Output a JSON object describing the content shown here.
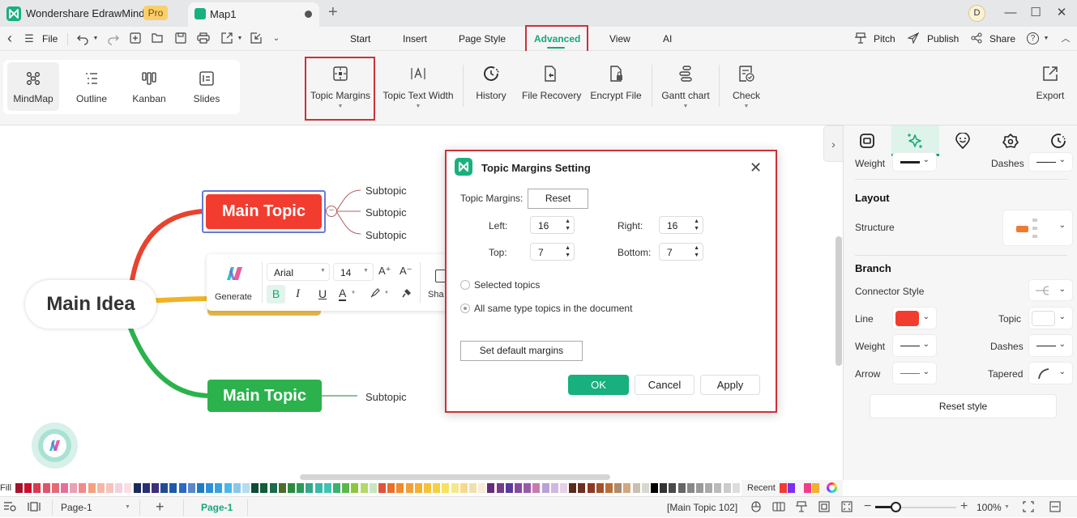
{
  "titlebar": {
    "app_title": "Wondershare EdrawMind",
    "badge": "Pro",
    "doc_tab": "Map1",
    "new_tab_symbol": "+",
    "avatar_initial": "D",
    "minimize": "—",
    "maximize": "☐",
    "close": "✕"
  },
  "menubar": {
    "back": "‹",
    "menu": "☰",
    "file": "File",
    "tabs": [
      "Start",
      "Insert",
      "Page Style",
      "Advanced",
      "View",
      "AI"
    ],
    "active_tab": "Advanced",
    "right": {
      "pitch": "Pitch",
      "publish": "Publish",
      "share": "Share",
      "help": "?"
    }
  },
  "ribbon": {
    "views": [
      {
        "label": "MindMap",
        "icon": "mindmap-icon",
        "active": true
      },
      {
        "label": "Outline",
        "icon": "outline-icon",
        "active": false
      },
      {
        "label": "Kanban",
        "icon": "kanban-icon",
        "active": false
      },
      {
        "label": "Slides",
        "icon": "slides-icon",
        "active": false
      }
    ],
    "tools": [
      {
        "label": "Topic Margins",
        "icon": "topic-margins-icon",
        "dropdown": true,
        "highlighted": true
      },
      {
        "label": "Topic Text Width",
        "icon": "text-width-icon",
        "dropdown": true
      },
      {
        "label": "History",
        "icon": "history-icon",
        "dropdown": false
      },
      {
        "label": "File Recovery",
        "icon": "file-recovery-icon",
        "dropdown": false
      },
      {
        "label": "Encrypt File",
        "icon": "encrypt-file-icon",
        "dropdown": false
      },
      {
        "label": "Gantt chart",
        "icon": "gantt-icon",
        "dropdown": true
      },
      {
        "label": "Check",
        "icon": "check-icon",
        "dropdown": true
      }
    ],
    "export": "Export"
  },
  "canvas": {
    "main_idea": "Main Idea",
    "topics": [
      {
        "label": "Main Topic",
        "color": "#f23c2f",
        "selected": true,
        "subtopics": [
          "Subtopic",
          "Subtopic",
          "Subtopic"
        ]
      },
      {
        "label": "Main Topic",
        "color": "#2bb24c",
        "selected": false,
        "subtopics": [
          "Subtopic"
        ]
      }
    ],
    "branch_colors": {
      "red": "#e8432f",
      "yellow": "#f0b323",
      "green": "#2bb24c"
    }
  },
  "float_toolbar": {
    "generate": "Generate",
    "font": "Arial",
    "size": "14",
    "grow": "A⁺",
    "shrink": "A⁻",
    "bold": "B",
    "italic": "I",
    "underline": "U",
    "font_color": "A",
    "shape_partial": "Sha"
  },
  "dialog": {
    "title": "Topic Margins Setting",
    "margins_label": "Topic Margins:",
    "reset": "Reset",
    "left_label": "Left:",
    "left_value": "16",
    "right_label": "Right:",
    "right_value": "16",
    "top_label": "Top:",
    "top_value": "7",
    "bottom_label": "Bottom:",
    "bottom_value": "7",
    "option_selected": "Selected topics",
    "option_all": "All same type topics in the document",
    "selected_option": "All same type topics in the document",
    "set_default": "Set default margins",
    "ok": "OK",
    "cancel": "Cancel",
    "apply": "Apply"
  },
  "right_panel": {
    "tabs": [
      "style-icon",
      "ai-sparkle-icon",
      "icon-marker-icon",
      "theme-icon",
      "clock-icon"
    ],
    "active_tab": 1,
    "weight_label": "Weight",
    "dashes_label": "Dashes",
    "layout_heading": "Layout",
    "structure_label": "Structure",
    "branch_heading": "Branch",
    "connector_label": "Connector Style",
    "line_label": "Line",
    "line_color": "#f23c2f",
    "topic_label": "Topic",
    "branch_weight_label": "Weight",
    "branch_dashes_label": "Dashes",
    "arrow_label": "Arrow",
    "tapered_label": "Tapered",
    "reset_style": "Reset style"
  },
  "palette": {
    "fill_label": "Fill",
    "recent_label": "Recent",
    "colors": [
      "#a3142c",
      "#c8102e",
      "#d93a4f",
      "#e0546b",
      "#e56a78",
      "#e86e9a",
      "#eaa0b8",
      "#f28a8a",
      "#f4a07d",
      "#f5b8a8",
      "#f6c4bc",
      "#efd3de",
      "#fadfe5",
      "#1b2a5a",
      "#28306e",
      "#3d2f7a",
      "#234b8f",
      "#1f5aa6",
      "#2d68c4",
      "#5a86cc",
      "#1f7cc4",
      "#2e8fd8",
      "#3aa0e0",
      "#4db7ea",
      "#8cc7e8",
      "#b6dcf0",
      "#0f4a3a",
      "#145c3a",
      "#1c6b4a",
      "#4c6b2e",
      "#2a8a3e",
      "#2a9a5a",
      "#36a88a",
      "#3ab8a8",
      "#40c4b0",
      "#3cb070",
      "#5ab84a",
      "#8dc63f",
      "#b5d86a",
      "#c8e6c0",
      "#e0523a",
      "#e8702a",
      "#f08a2a",
      "#f0a03a",
      "#f4b030",
      "#f5c23a",
      "#f6d040",
      "#f8e060",
      "#f5e88a",
      "#f8d890",
      "#f0e0b0",
      "#f8ecd8",
      "#6a2a7a",
      "#7a3a8a",
      "#5a3a9a",
      "#8a4a9a",
      "#9a5aa8",
      "#c87ab0",
      "#b8a0d8",
      "#d0b8e0",
      "#e8d0e8",
      "#5a2a1a",
      "#6a3020",
      "#8a3a20",
      "#a0522d",
      "#b8703a",
      "#b08a6a",
      "#d0a880",
      "#c8c0b0",
      "#d8d8d0",
      "#000000",
      "#333333",
      "#4a4a4a",
      "#666666",
      "#888888",
      "#999999",
      "#aaaaaa",
      "#bbbbbb",
      "#cccccc",
      "#dddddd"
    ],
    "recent_colors": [
      "#f23c2f",
      "#7b2ff2",
      "#f23c8a",
      "#f2b02f"
    ]
  },
  "statusbar": {
    "page_select": "Page-1",
    "add_page": "+",
    "active_page": "Page-1",
    "selection": "[Main Topic 102]",
    "zoom_minus": "−",
    "zoom_plus": "+",
    "zoom_level": "100%",
    "zoom_fraction": 0.25
  }
}
